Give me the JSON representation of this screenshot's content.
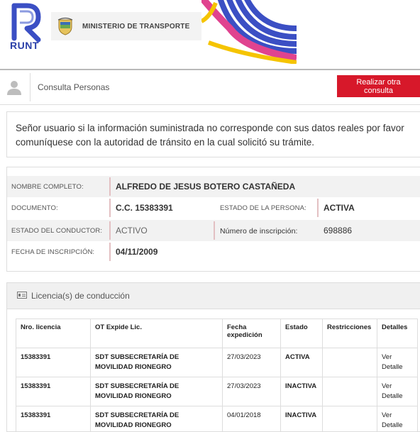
{
  "header": {
    "logo_text": "RUNT",
    "ministry": "MINISTERIO DE TRANSPORTE",
    "colors": {
      "runt_blue": "#2a3fa8",
      "wave_blue": "#3b4fc4",
      "wave_yellow": "#f5c400",
      "wave_pink": "#e0438f"
    }
  },
  "bar": {
    "title": "Consulta Personas",
    "button": "Realizar otra consulta",
    "icon": "user-icon",
    "button_color": "#d7182a"
  },
  "notice": "Señor usuario si la información suministrada no corresponde con sus datos reales por favor comuníquese con la autoridad de tránsito en la cual solicitó su trámite.",
  "person": {
    "nombre_label": "NOMBRE COMPLETO:",
    "nombre": "ALFREDO DE JESUS BOTERO CASTAÑEDA",
    "documento_label": "DOCUMENTO:",
    "documento": "C.C. 15383391",
    "estado_persona_label": "ESTADO DE LA PERSONA:",
    "estado_persona": "ACTIVA",
    "estado_conductor_label": "ESTADO DEL CONDUCTOR:",
    "estado_conductor": "ACTIVO",
    "inscripcion_label": "Número de inscripción:",
    "inscripcion": "698886",
    "fecha_label": "FECHA DE INSCRIPCIÓN:",
    "fecha": "04/11/2009"
  },
  "licenses": {
    "title": "Licencia(s) de conducción",
    "icon": "license-card-icon",
    "columns": [
      "Nro. licencia",
      "OT Expide Lic.",
      "Fecha expedición",
      "Estado",
      "Restricciones",
      "Detalles"
    ],
    "rows": [
      {
        "nro": "15383391",
        "ot": "SDT SUBSECRETARÍA DE MOVILIDAD RIONEGRO",
        "fecha": "27/03/2023",
        "estado": "ACTIVA",
        "restricciones": "",
        "detalle": "Ver Detalle"
      },
      {
        "nro": "15383391",
        "ot": "SDT SUBSECRETARÍA DE MOVILIDAD RIONEGRO",
        "fecha": "27/03/2023",
        "estado": "INACTIVA",
        "restricciones": "",
        "detalle": "Ver Detalle"
      },
      {
        "nro": "15383391",
        "ot": "SDT SUBSECRETARÍA DE MOVILIDAD RIONEGRO",
        "fecha": "04/01/2018",
        "estado": "INACTIVA",
        "restricciones": "",
        "detalle": "Ver Detalle"
      }
    ]
  }
}
